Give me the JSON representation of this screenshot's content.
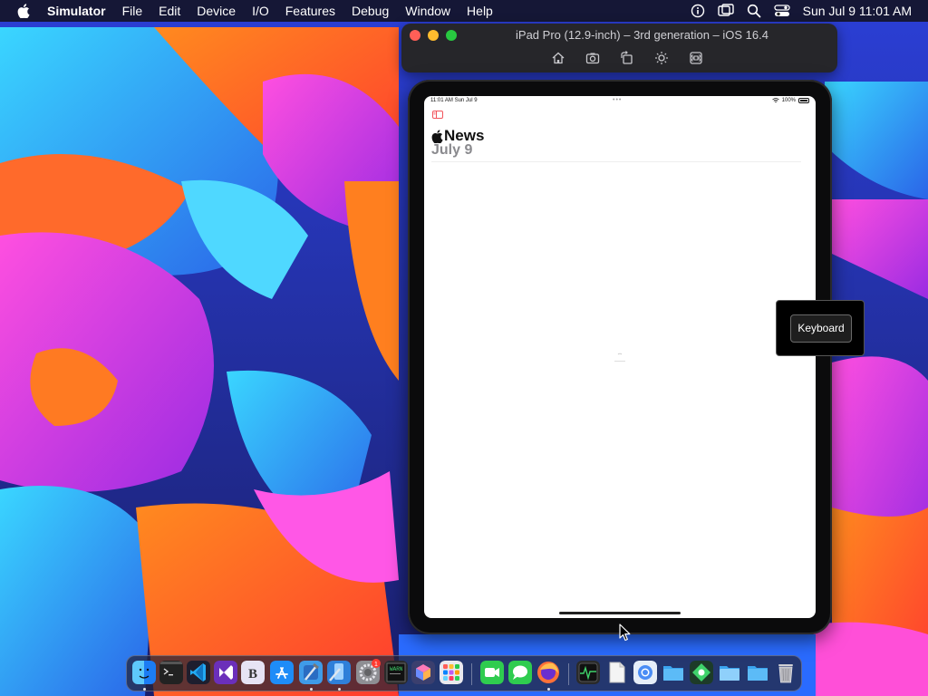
{
  "menubar": {
    "app_name": "Simulator",
    "menus": [
      "File",
      "Edit",
      "Device",
      "I/O",
      "Features",
      "Debug",
      "Window",
      "Help"
    ],
    "clock": "Sun Jul 9  11:01 AM"
  },
  "simulator_window": {
    "title": "iPad Pro (12.9-inch) – 3rd generation – iOS 16.4",
    "toolbar_icons": [
      "home-icon",
      "screenshot-icon",
      "rotate-icon",
      "appearance-icon",
      "keyboard-shortcut-icon"
    ],
    "traffic_lights": {
      "close": "#ff5f57",
      "minimize": "#febc2e",
      "zoom": "#28c840"
    }
  },
  "ipad": {
    "status_time": "11:01 AM  Sun Jul 9",
    "status_battery": "100%",
    "app_title": "News",
    "date": "July 9",
    "accent": "#f2545b"
  },
  "keyboard_popover": {
    "label": "Keyboard"
  },
  "dock": {
    "apps": [
      {
        "name": "finder",
        "icon": "finder-icon",
        "running": true
      },
      {
        "name": "terminal",
        "icon": "terminal-icon",
        "running": false
      },
      {
        "name": "vscode",
        "icon": "vscode-icon",
        "running": false
      },
      {
        "name": "visual-studio",
        "icon": "visual-studio-icon",
        "running": false
      },
      {
        "name": "bbedit",
        "icon": "bbedit-icon",
        "running": false
      },
      {
        "name": "app-store",
        "icon": "app-store-icon",
        "running": false
      },
      {
        "name": "xcode",
        "icon": "xcode-icon",
        "running": true
      },
      {
        "name": "simulator",
        "icon": "simulator-icon",
        "running": true
      },
      {
        "name": "system-settings",
        "icon": "system-settings-icon",
        "running": false,
        "badge": "1"
      },
      {
        "name": "console",
        "icon": "console-icon",
        "running": false
      },
      {
        "name": "cube-app",
        "icon": "cube-icon",
        "running": false
      },
      {
        "name": "launchpad",
        "icon": "launchpad-icon",
        "running": false
      },
      {
        "name": "facetime",
        "icon": "facetime-icon",
        "running": false
      },
      {
        "name": "messages",
        "icon": "messages-icon",
        "running": false
      },
      {
        "name": "firefox",
        "icon": "firefox-icon",
        "running": true
      },
      {
        "name": "activity-monitor",
        "icon": "activity-monitor-icon",
        "running": false
      },
      {
        "name": "document",
        "icon": "document-icon",
        "running": false
      },
      {
        "name": "chrome-app",
        "icon": "chrome-app-icon",
        "running": false
      },
      {
        "name": "folder",
        "icon": "folder-icon",
        "running": false
      },
      {
        "name": "sourcetree",
        "icon": "sourcetree-icon",
        "running": false
      },
      {
        "name": "folder-2",
        "icon": "folder-icon",
        "running": false
      },
      {
        "name": "folder-3",
        "icon": "folder-icon",
        "running": false
      },
      {
        "name": "trash",
        "icon": "trash-icon",
        "running": false
      }
    ]
  }
}
